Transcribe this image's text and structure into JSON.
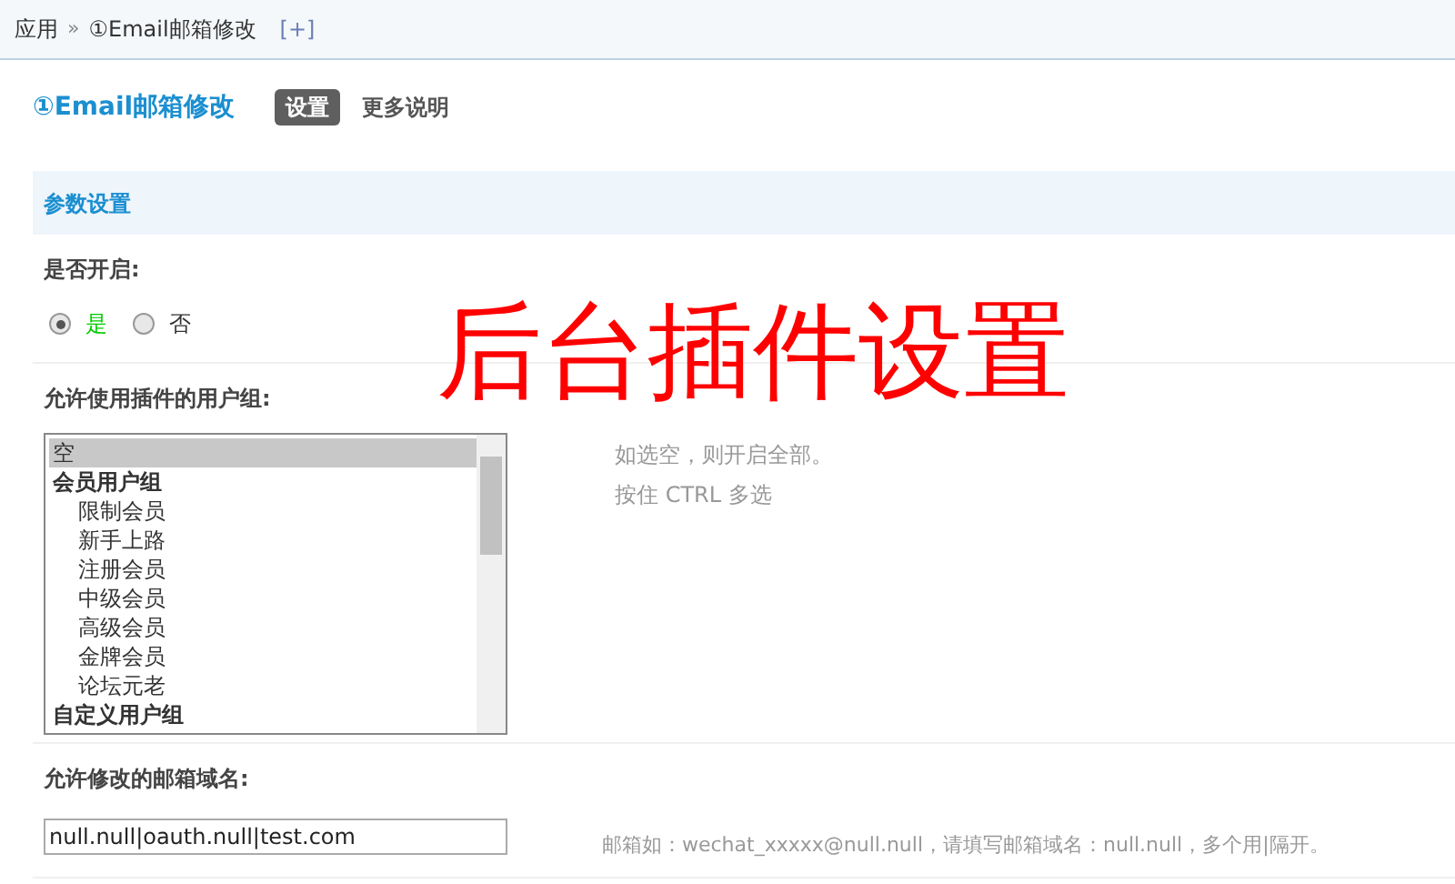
{
  "breadcrumb": {
    "items": [
      "应用",
      "①Email邮箱修改"
    ],
    "separator": "»",
    "add": "[+]"
  },
  "header": {
    "title": "①Email邮箱修改",
    "tabs": [
      {
        "label": "设置",
        "selected": true
      },
      {
        "label": "更多说明",
        "selected": false
      }
    ]
  },
  "section": {
    "title": "参数设置"
  },
  "enable": {
    "label": "是否开启:",
    "options": [
      {
        "label": "是",
        "selected": true
      },
      {
        "label": "否",
        "selected": false
      }
    ]
  },
  "groups": {
    "label": "允许使用插件的用户组:",
    "items": [
      {
        "kind": "option",
        "label": "空",
        "selected": true
      },
      {
        "kind": "group",
        "label": "会员用户组",
        "selected": false
      },
      {
        "kind": "option",
        "label": "限制会员",
        "selected": false
      },
      {
        "kind": "option",
        "label": "新手上路",
        "selected": false
      },
      {
        "kind": "option",
        "label": "注册会员",
        "selected": false
      },
      {
        "kind": "option",
        "label": "中级会员",
        "selected": false
      },
      {
        "kind": "option",
        "label": "高级会员",
        "selected": false
      },
      {
        "kind": "option",
        "label": "金牌会员",
        "selected": false
      },
      {
        "kind": "option",
        "label": "论坛元老",
        "selected": false
      },
      {
        "kind": "group",
        "label": "自定义用户组",
        "selected": false
      }
    ],
    "hints": [
      "如选空，则开启全部。",
      "按住 CTRL 多选"
    ]
  },
  "domains": {
    "label": "允许修改的邮箱域名:",
    "value": "null.null|oauth.null|test.com",
    "hint": "邮箱如：wechat_xxxxx@null.null，请填写邮箱域名：null.null，多个用|隔开。"
  },
  "annotation": "后台插件设置"
}
